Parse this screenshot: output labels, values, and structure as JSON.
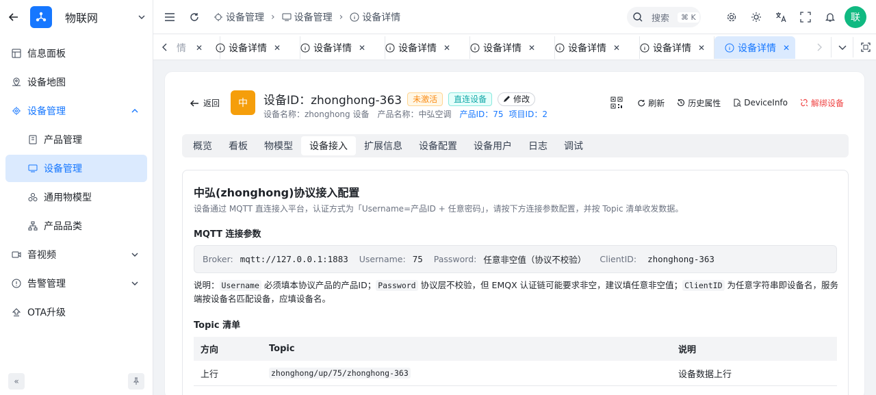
{
  "app": {
    "name": "物联网",
    "logo_icon": "network-hub-icon",
    "accent": "#1677ff"
  },
  "sidebar": {
    "items": [
      {
        "label": "信息面板",
        "icon": "dashboard-icon"
      },
      {
        "label": "设备地图",
        "icon": "map-icon"
      },
      {
        "label": "设备管理",
        "icon": "gear-chip-icon",
        "expanded": true
      },
      {
        "label": "产品管理",
        "icon": "product-icon"
      },
      {
        "label": "设备管理",
        "icon": "device-icon",
        "active": true
      },
      {
        "label": "通用物模型",
        "icon": "model-icon"
      },
      {
        "label": "产品品类",
        "icon": "category-icon"
      },
      {
        "label": "音视频",
        "icon": "video-icon"
      },
      {
        "label": "告警管理",
        "icon": "alert-icon"
      },
      {
        "label": "OTA升级",
        "icon": "upgrade-icon"
      }
    ]
  },
  "topbar": {
    "breadcrumb": [
      "设备管理",
      "设备管理",
      "设备详情"
    ],
    "search_label": "搜索",
    "search_shortcut": "⌘ K",
    "avatar_text": "联"
  },
  "tabs": {
    "partial_label": "情",
    "items": [
      "设备详情",
      "设备详情",
      "设备详情",
      "设备详情",
      "设备详情",
      "设备详情",
      "设备详情"
    ]
  },
  "device": {
    "back_label": "返回",
    "icon_text": "中",
    "title": "设备ID：zhonghong-363",
    "status_tag": "未激活",
    "conn_tag": "直连设备",
    "edit_label": "修改",
    "meta_name": "设备名称：zhonghong 设备",
    "meta_product": "产品名称：中弘空调",
    "meta_product_id": "产品ID：75",
    "meta_project_id": "项目ID：2",
    "actions": {
      "refresh": "刷新",
      "history": "历史属性",
      "info": "DeviceInfo",
      "unbind": "解绑设备"
    }
  },
  "subtabs": [
    "概览",
    "看板",
    "物模型",
    "设备接入",
    "扩展信息",
    "设备配置",
    "设备用户",
    "日志",
    "调试"
  ],
  "access": {
    "title": "中弘(zhonghong)协议接入配置",
    "desc": "设备通过 MQTT 直连接入平台，认证方式为「Username=产品ID + 任意密码」，请按下方连接参数配置，并按 Topic 清单收发数据。",
    "mqtt_heading": "MQTT 连接参数",
    "params": {
      "broker_k": "Broker:",
      "broker_v": "mqtt://127.0.0.1:1883",
      "user_k": "Username:",
      "user_v": "75",
      "pass_k": "Password:",
      "pass_v": "任意非空值（协议不校验）",
      "client_k": "ClientID:",
      "client_v": "zhonghong-363"
    },
    "note": {
      "p1": "说明：",
      "c1": "Username",
      "p2": " 必须填本协议产品的产品ID；",
      "c2": "Password",
      "p3": " 协议层不校验，但 EMQX 认证链可能要求非空，建议填任意非空值；",
      "c3": "ClientID",
      "p4": " 为任意字符串即设备名，服务端按设备名匹配设备，应填设备名。"
    },
    "topic_heading": "Topic 清单",
    "table": {
      "headers": [
        "方向",
        "Topic",
        "说明"
      ],
      "rows": [
        {
          "dir": "上行",
          "topic": "zhonghong/up/75/zhonghong-363",
          "desc": "设备数据上行"
        }
      ]
    }
  }
}
